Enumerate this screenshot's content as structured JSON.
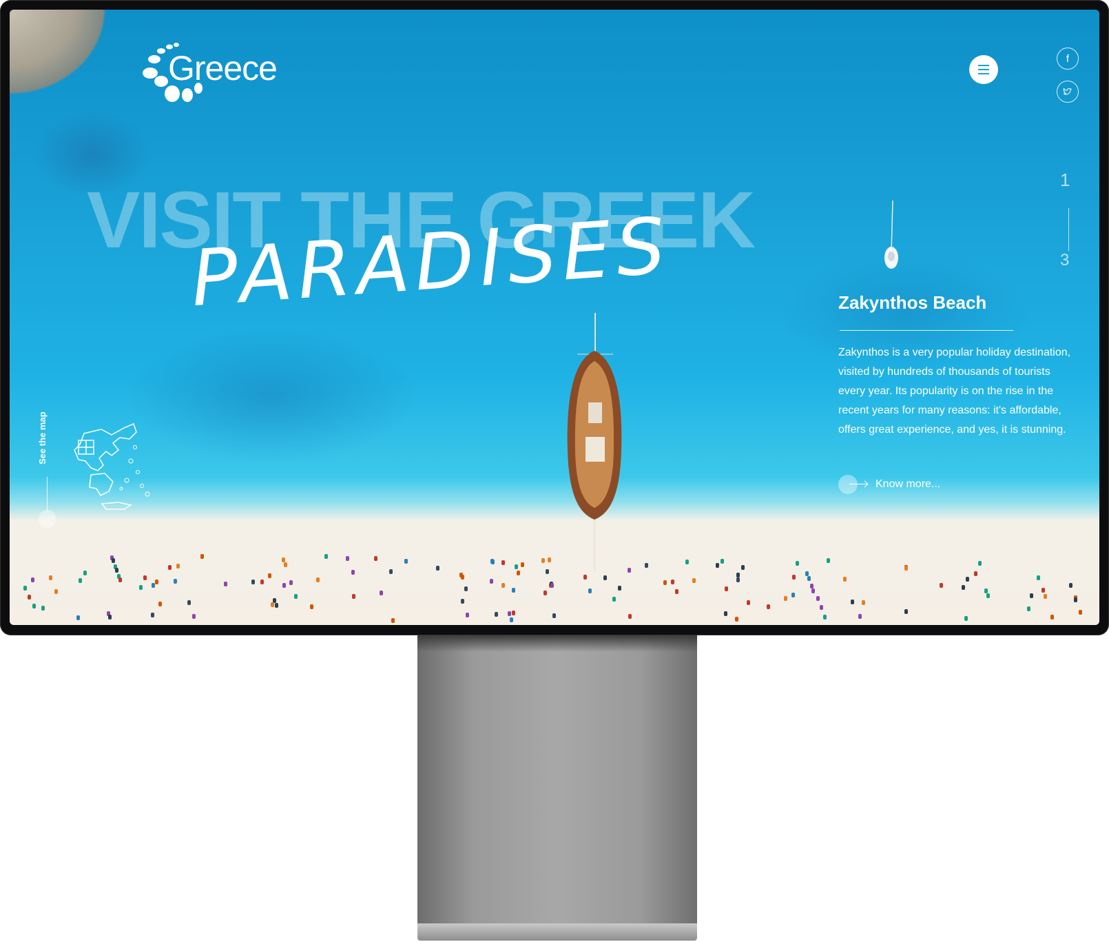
{
  "brand": {
    "logo_text": "Greece"
  },
  "header": {
    "menu_icon": "hamburger-icon",
    "social": [
      {
        "name": "facebook",
        "glyph": "f"
      },
      {
        "name": "twitter",
        "glyph": "t"
      }
    ]
  },
  "hero": {
    "headline": "VISIT THE GREEK",
    "script_word": "PARADISES"
  },
  "slider": {
    "current": "1",
    "total": "3"
  },
  "info": {
    "title": "Zakynthos Beach",
    "description": "Zakynthos is a very popular holiday destination, visited by hundreds of thousands of tourists every year. Its popularity is on the rise in the recent years for many reasons: it's affordable, offers great experience, and yes, it is stunning.",
    "cta": "Know more..."
  },
  "map_link": {
    "label": "See the map"
  },
  "colors": {
    "sea": "#1aa3d8",
    "sand": "#f5efe6",
    "accent": "#ffffff"
  }
}
